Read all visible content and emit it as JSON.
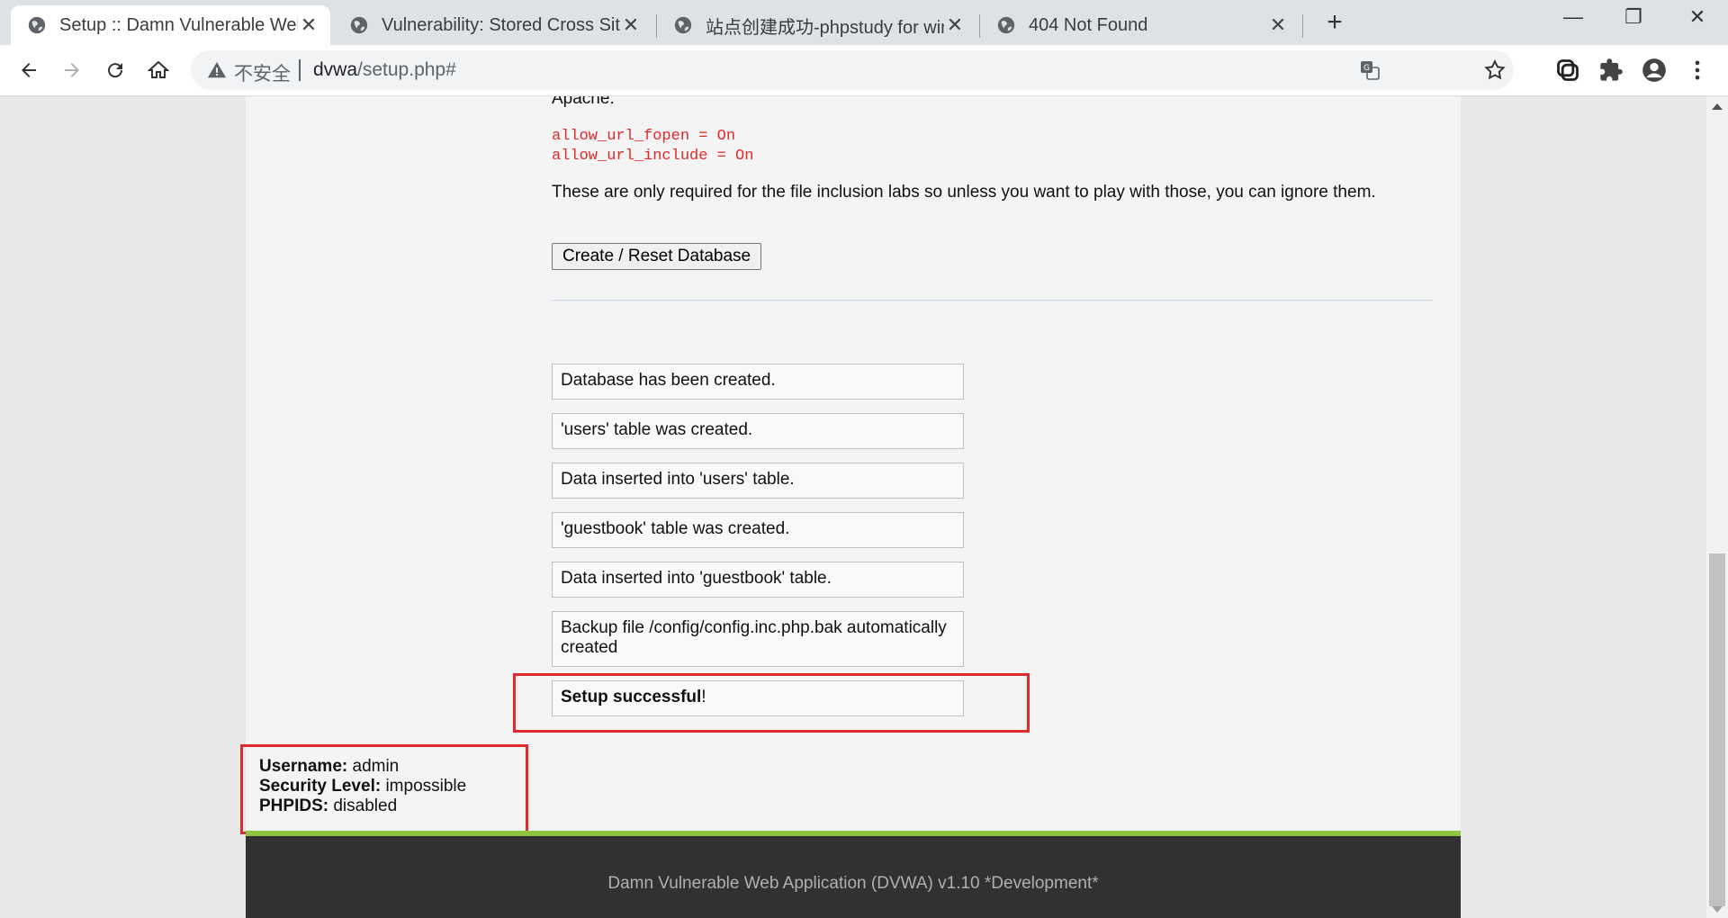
{
  "browser": {
    "tabs": [
      {
        "title": "Setup :: Damn Vulnerable Web",
        "close": "✕"
      },
      {
        "title": "Vulnerability: Stored Cross Site",
        "close": "✕"
      },
      {
        "title": "站点创建成功-phpstudy for win",
        "close": "✕"
      },
      {
        "title": "404 Not Found",
        "close": "✕"
      }
    ],
    "new_tab": "+",
    "window_controls": {
      "minimize": "—",
      "restore": "❐",
      "close": "✕"
    },
    "address": {
      "security_label": "不安全",
      "host": "dvwa",
      "path": "/setup.php#"
    }
  },
  "page": {
    "apache_text": "Apache.",
    "php_settings": [
      "allow_url_fopen = On",
      "allow_url_include = On"
    ],
    "note": "These are only required for the file inclusion labs so unless you want to play with those, you can ignore them.",
    "reset_button": "Create / Reset Database",
    "messages": [
      "Database has been created.",
      "'users' table was created.",
      "Data inserted into 'users' table.",
      "'guestbook' table was created.",
      "Data inserted into 'guestbook' table.",
      "Backup file /config/config.inc.php.bak automatically created"
    ],
    "success": {
      "bold": "Setup successful",
      "rest": "!"
    },
    "user_info": {
      "username_label": "Username:",
      "username": "admin",
      "security_label": "Security Level:",
      "security": "impossible",
      "phpids_label": "PHPIDS:",
      "phpids": "disabled"
    },
    "footer": "Damn Vulnerable Web Application (DVWA) v1.10 *Development*"
  },
  "colors": {
    "highlight": "#e02b2b",
    "accent_bar": "#8cc63f",
    "footer_bg": "#313131",
    "code_red": "#e32828"
  }
}
